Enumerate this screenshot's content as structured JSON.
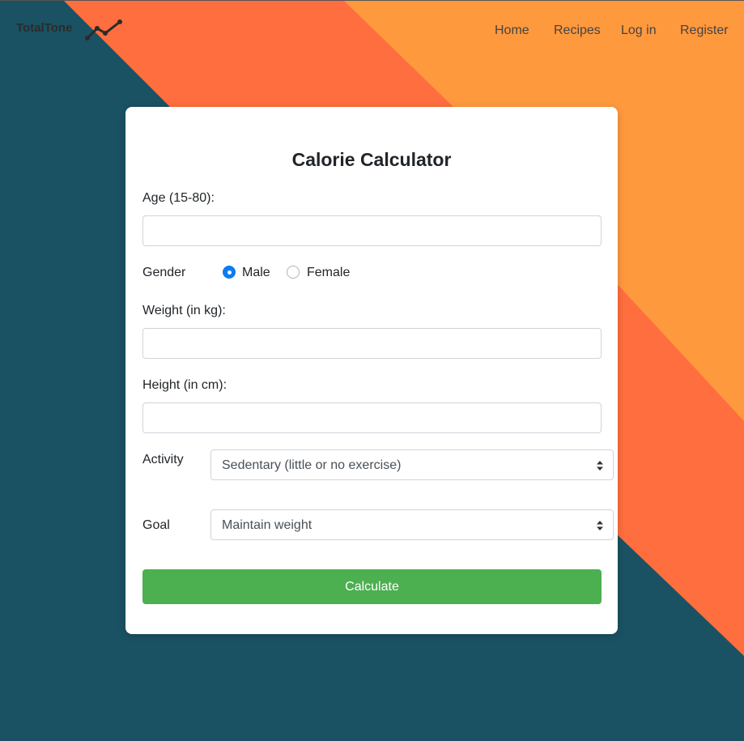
{
  "colors": {
    "background_dark": "#1a5263",
    "stripe_red": "#ff6e3e",
    "stripe_orange": "#ff993e",
    "button_green": "#4caf50",
    "radio_blue": "#0d7bf0"
  },
  "brand": {
    "name": "TotalTone",
    "icon": "line-chart-icon"
  },
  "nav": {
    "items": [
      {
        "label": "Home"
      },
      {
        "label": "Recipes"
      },
      {
        "label": "Log in"
      },
      {
        "label": "Register"
      }
    ]
  },
  "form": {
    "title": "Calorie Calculator",
    "age": {
      "label": "Age (15-80):",
      "value": "",
      "placeholder": ""
    },
    "gender": {
      "label": "Gender",
      "options": [
        {
          "label": "Male",
          "checked": true
        },
        {
          "label": "Female",
          "checked": false
        }
      ]
    },
    "weight": {
      "label": "Weight (in kg):",
      "value": "",
      "placeholder": ""
    },
    "height": {
      "label": "Height (in cm):",
      "value": "",
      "placeholder": ""
    },
    "activity": {
      "label": "Activity",
      "selected": "Sedentary (little or no exercise)"
    },
    "goal": {
      "label": "Goal",
      "selected": "Maintain weight"
    },
    "submit_label": "Calculate"
  }
}
